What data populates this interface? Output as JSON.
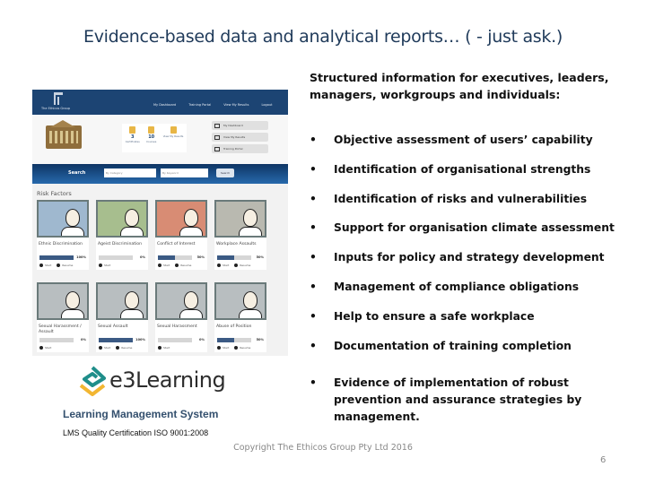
{
  "slide": {
    "title": "Evidence-based data and analytical reports… ( - just ask.)",
    "intro": "Structured  information for executives, leaders, managers, workgroups and individuals:",
    "bullet_char": "•",
    "bullets": [
      "Objective assessment of users’ capability",
      "Identification of organisational strengths",
      "Identification of risks and vulnerabilities",
      "Support for organisation climate assessment",
      "Inputs for policy and strategy development",
      "Management of compliance obligations",
      "Help to ensure a safe workplace",
      "Documentation of training completion",
      "Evidence of implementation of robust prevention and assurance strategies by management."
    ],
    "copyright": "Copyright The Ethicos Group Pty Ltd 2016",
    "page_number": "6"
  },
  "logo": {
    "brand": "e3Learning",
    "subtitle": "Learning Management System",
    "certification": "LMS Quality Certification ISO 9001:2008",
    "colors": {
      "teal": "#1f8e8a",
      "gold": "#f2b632",
      "text": "#2d2d2d"
    }
  },
  "screenshot": {
    "nav": {
      "logo_text": "The Ethicos Group",
      "links": [
        "My Dashboard",
        "Training Portal",
        "View My Results",
        "Logout"
      ]
    },
    "stats": [
      {
        "num": "3",
        "label": "Certificates"
      },
      {
        "num": "10",
        "label": "Courses"
      },
      {
        "num": "",
        "label": "View My Results"
      }
    ],
    "quick_links": [
      "My Dashboard",
      "View My Results",
      "Training Portal"
    ],
    "search": {
      "label": "Search",
      "category_placeholder": "By Category",
      "keyword_placeholder": "By Keyword",
      "button": "Search"
    },
    "risk_title": "Risk Factors",
    "cards": [
      {
        "name": "Ethnic Discrimination",
        "progress": 100,
        "pct": "100%",
        "actions": [
          "Start",
          "Resume"
        ],
        "theme": "#9fb8cf"
      },
      {
        "name": "Ageist Discrimination",
        "progress": 0,
        "pct": "0%",
        "actions": [
          "Start"
        ],
        "theme": "#a7be8e"
      },
      {
        "name": "Conflict of Interest",
        "progress": 50,
        "pct": "50%",
        "actions": [
          "Start",
          "Resume"
        ],
        "theme": "#d88c74"
      },
      {
        "name": "Workplace Assaults",
        "progress": 50,
        "pct": "50%",
        "actions": [
          "Start",
          "Resume"
        ],
        "theme": "#b9b9b0"
      },
      {
        "name": "Sexual Harassment / Assault",
        "progress": 0,
        "pct": "0%",
        "actions": [
          "Start"
        ],
        "theme": "#b8bec0"
      },
      {
        "name": "Sexual Assault",
        "progress": 100,
        "pct": "100%",
        "actions": [
          "Start",
          "Resume"
        ],
        "theme": "#b8bec0"
      },
      {
        "name": "Sexual Harassment",
        "progress": 0,
        "pct": "0%",
        "actions": [
          "Start"
        ],
        "theme": "#b8bec0"
      },
      {
        "name": "Abuse of Position",
        "progress": 50,
        "pct": "50%",
        "actions": [
          "Start",
          "Resume"
        ],
        "theme": "#b8bec0"
      }
    ],
    "colors": {
      "nav": "#1c4473",
      "bar_fill": "#3b5a84",
      "bar_track": "#d6d6d6"
    }
  }
}
